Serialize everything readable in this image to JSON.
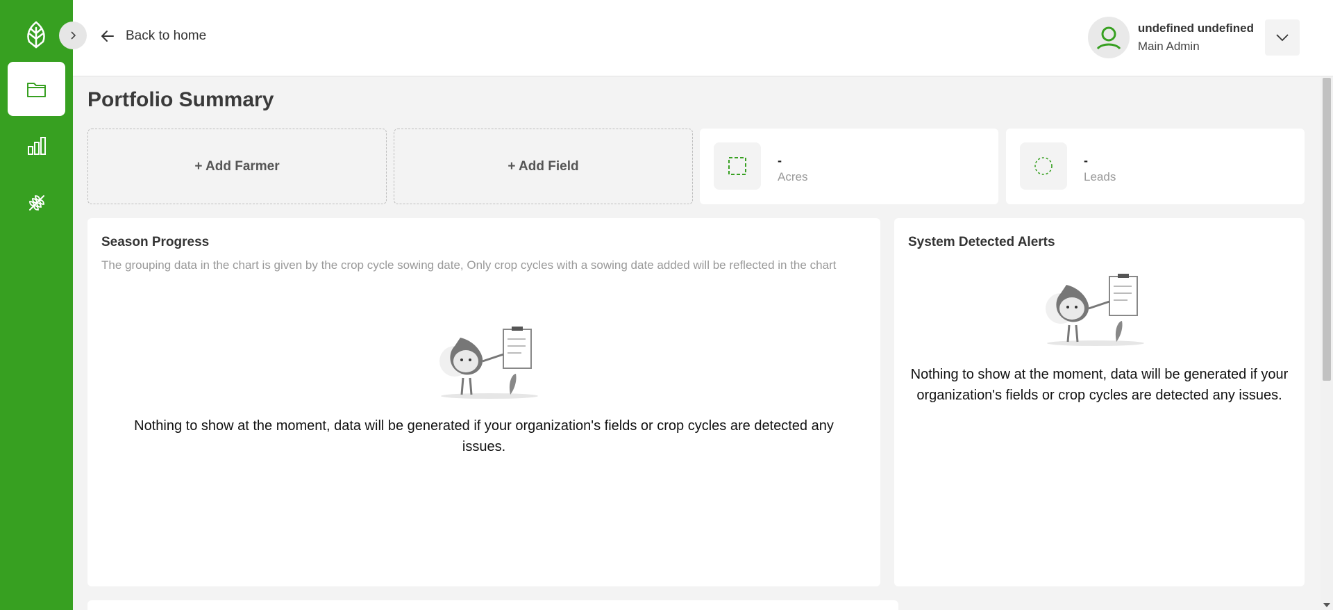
{
  "header": {
    "back_label": "Back to home",
    "user_name": "undefined undefined",
    "user_role": "Main Admin"
  },
  "page": {
    "title": "Portfolio Summary"
  },
  "cards": {
    "add_farmer": "+ Add Farmer",
    "add_field": "+ Add Field",
    "acres": {
      "value": "-",
      "label": "Acres"
    },
    "leads": {
      "value": "-",
      "label": "Leads"
    }
  },
  "season_progress": {
    "title": "Season Progress",
    "subtitle": "The grouping data in the chart is given by the crop cycle sowing date, Only crop cycles with a sowing date added will be reflected in the chart",
    "empty_message": "Nothing to show at the moment, data will be generated if your organization's fields or crop cycles are detected any issues."
  },
  "alerts": {
    "title": "System Detected Alerts",
    "empty_message": "Nothing to show at the moment, data will be generated if your organization's fields or crop cycles are detected any issues."
  },
  "icons": {
    "logo": "leaf-logo-icon",
    "nav": [
      "folder-icon",
      "bar-chart-icon",
      "wheat-icon"
    ],
    "collapse": "chevron-right-icon",
    "back": "arrow-left-icon",
    "avatar": "user-icon",
    "dropdown": "chevron-down-icon"
  },
  "colors": {
    "brand": "#37a021",
    "background": "#f3f3f3"
  }
}
